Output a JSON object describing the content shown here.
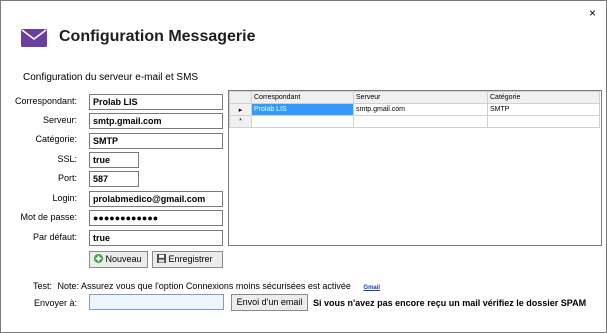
{
  "window": {
    "close_glyph": "×"
  },
  "header": {
    "title": "Configuration Messagerie",
    "icon": "envelope-icon",
    "accent": "#6b3fa0"
  },
  "section_title": "Configuration du serveur e-mail et SMS",
  "form": {
    "correspondant": {
      "label": "Correspondant:",
      "value": "Prolab LIS"
    },
    "serveur": {
      "label": "Serveur:",
      "value": "smtp.gmail.com"
    },
    "categorie": {
      "label": "Catégorie:",
      "value": "SMTP"
    },
    "ssl": {
      "label": "SSL:",
      "value": "true"
    },
    "port": {
      "label": "Port:",
      "value": "587"
    },
    "login": {
      "label": "Login:",
      "value": "prolabmedico@gmail.com"
    },
    "motdepasse": {
      "label": "Mot de passe:",
      "value": "●●●●●●●●●●●●"
    },
    "pardefaut": {
      "label": "Par défaut:",
      "value": "true"
    }
  },
  "buttons": {
    "nouveau": "Nouveau",
    "enregistrer": "Enregistrer",
    "envoi": "Envoi d'un email"
  },
  "grid": {
    "columns": [
      "Correspondant",
      "Serveur",
      "Catégorie"
    ],
    "rows": [
      {
        "marker": "▸",
        "correspondant": "Prolab LIS",
        "serveur": "smtp.gmail.com",
        "categorie": "SMTP"
      }
    ],
    "new_row_marker": "*"
  },
  "test": {
    "label": "Test:",
    "note": "Note: Assurez vous que l'option Connexions moins sécurisées est activée",
    "link": "Gmail",
    "send_label": "Envoyer à:",
    "send_value": "",
    "hint": "Si vous n'avez pas encore reçu un mail vérifiez le dossier SPAM"
  }
}
